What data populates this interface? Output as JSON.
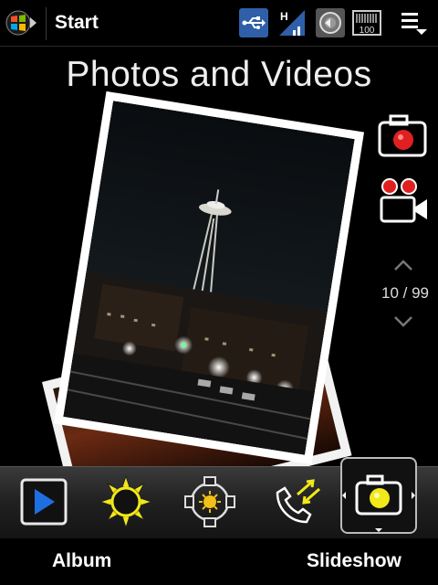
{
  "statusbar": {
    "start_label": "Start",
    "signal_letter": "H",
    "battery_label": "100"
  },
  "title": "Photos and Videos",
  "counter": "10 / 99",
  "softkeys": {
    "left": "Album",
    "right": "Slideshow"
  },
  "icons": {
    "start": "windows-flag-icon",
    "usb": "usb-icon",
    "signal": "signal-icon",
    "speaker": "speaker-icon",
    "battery": "battery-icon",
    "menu": "menu-icon",
    "camera": "camera-icon",
    "video": "video-camera-icon",
    "up": "chevron-up-icon",
    "down": "chevron-down-icon",
    "album": "play-icon",
    "sun": "sun-icon",
    "brightness": "brightness-icon",
    "call": "call-icon"
  },
  "colors": {
    "accent_red": "#e02020",
    "accent_yellow": "#f2e81a",
    "usb_blue": "#2f5fa8"
  }
}
